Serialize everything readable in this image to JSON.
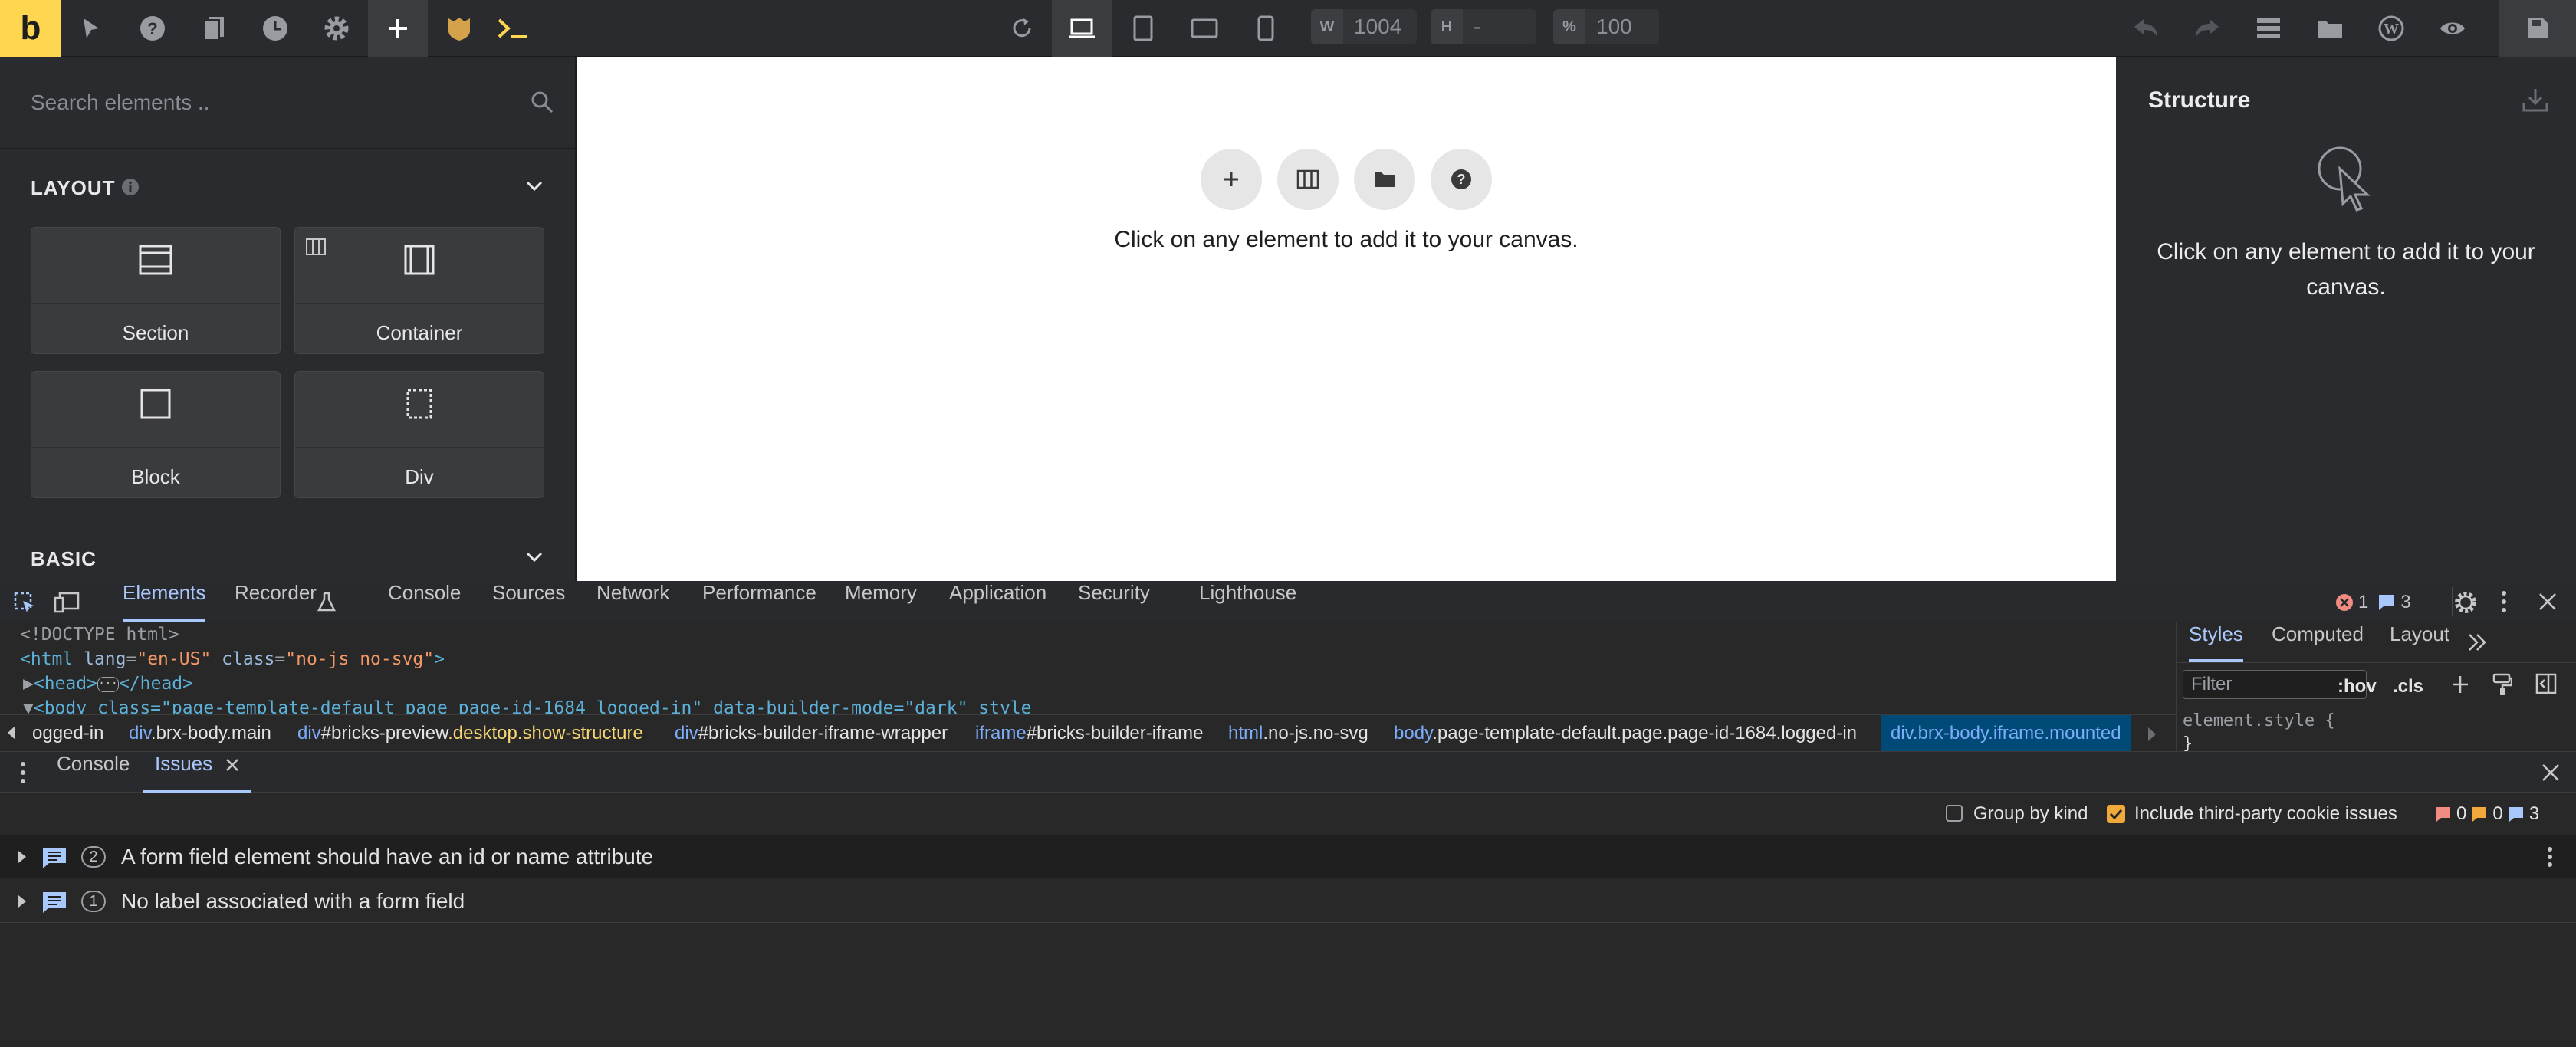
{
  "toolbar": {
    "logo": "b",
    "width_label": "W",
    "width_value": "1004",
    "height_label": "H",
    "height_value": "-",
    "zoom_label": "%",
    "zoom_value": "100",
    "icons_left": [
      "play-icon",
      "help-icon",
      "pages-icon",
      "history-icon",
      "settings-icon",
      "add-icon",
      "shield-icon",
      "terminal-icon"
    ],
    "icons_center": [
      "refresh-icon",
      "desktop-icon",
      "tablet-portrait-icon",
      "tablet-landscape-icon",
      "mobile-icon"
    ],
    "icons_right": [
      "undo-icon",
      "redo-icon",
      "structure-icon",
      "folder-icon",
      "wordpress-icon",
      "preview-icon",
      "save-icon"
    ]
  },
  "sidebar": {
    "search_placeholder": "Search elements ..",
    "layout_title": "LAYOUT",
    "basic_title": "BASIC",
    "elements": [
      {
        "label": "Section",
        "icon": "section-icon"
      },
      {
        "label": "Container",
        "icon": "container-icon"
      },
      {
        "label": "Block",
        "icon": "block-icon"
      },
      {
        "label": "Div",
        "icon": "div-icon"
      }
    ]
  },
  "canvas": {
    "hint": "Click on any element to add it to your canvas.",
    "buttons": [
      "add-icon",
      "layout-icon",
      "folder-icon",
      "help-icon"
    ]
  },
  "structure": {
    "title": "Structure",
    "hint": "Click on any element to add it to your canvas."
  },
  "devtools": {
    "tabs": [
      "Elements",
      "Recorder",
      "Console",
      "Sources",
      "Network",
      "Performance",
      "Memory",
      "Application",
      "Security",
      "Lighthouse"
    ],
    "error_count": "1",
    "message_count": "3",
    "dom": {
      "doctype": "<!DOCTYPE html>",
      "html_tag": "html",
      "html_attr1": "lang",
      "html_val1": "\"en-US\"",
      "html_attr2": "class",
      "html_val2": "\"no-js no-svg\"",
      "head_tag": "head",
      "body_line": "<body class=\"page-template-default page page-id-1684 logged-in\" data-builder-mode=\"dark\" style"
    },
    "breadcrumb": [
      {
        "n": "",
        "c": "ogged-in",
        "y": ""
      },
      {
        "n": "div",
        "c": ".brx-body.main",
        "y": ""
      },
      {
        "n": "div",
        "c": "#bricks-preview",
        "y": ".desktop.show-structure"
      },
      {
        "n": "div",
        "c": "#bricks-builder-iframe-wrapper",
        "y": ""
      },
      {
        "n": "iframe",
        "c": "#bricks-builder-iframe",
        "y": ""
      },
      {
        "n": "html",
        "c": ".no-js.no-svg",
        "y": ""
      },
      {
        "n": "body",
        "c": ".page-template-default.page.page-id-1684.logged-in",
        "y": ""
      },
      {
        "n": "div",
        "c": ".brx-body.iframe.mounted",
        "y": ""
      }
    ],
    "styles_tabs": [
      "Styles",
      "Computed",
      "Layout"
    ],
    "filter_placeholder": "Filter",
    "hov": ":hov",
    "cls": ".cls",
    "element_style": "element.style {",
    "element_style_close": "}",
    "drawer_tabs": [
      "Console",
      "Issues"
    ],
    "group_by_kind": "Group by kind",
    "include_third_party": "Include third-party cookie issues",
    "count_errors": "0",
    "count_warnings": "0",
    "count_info": "3",
    "issues": [
      {
        "count": "2",
        "text": "A form field element should have an id or name attribute"
      },
      {
        "count": "1",
        "text": "No label associated with a form field"
      }
    ]
  }
}
